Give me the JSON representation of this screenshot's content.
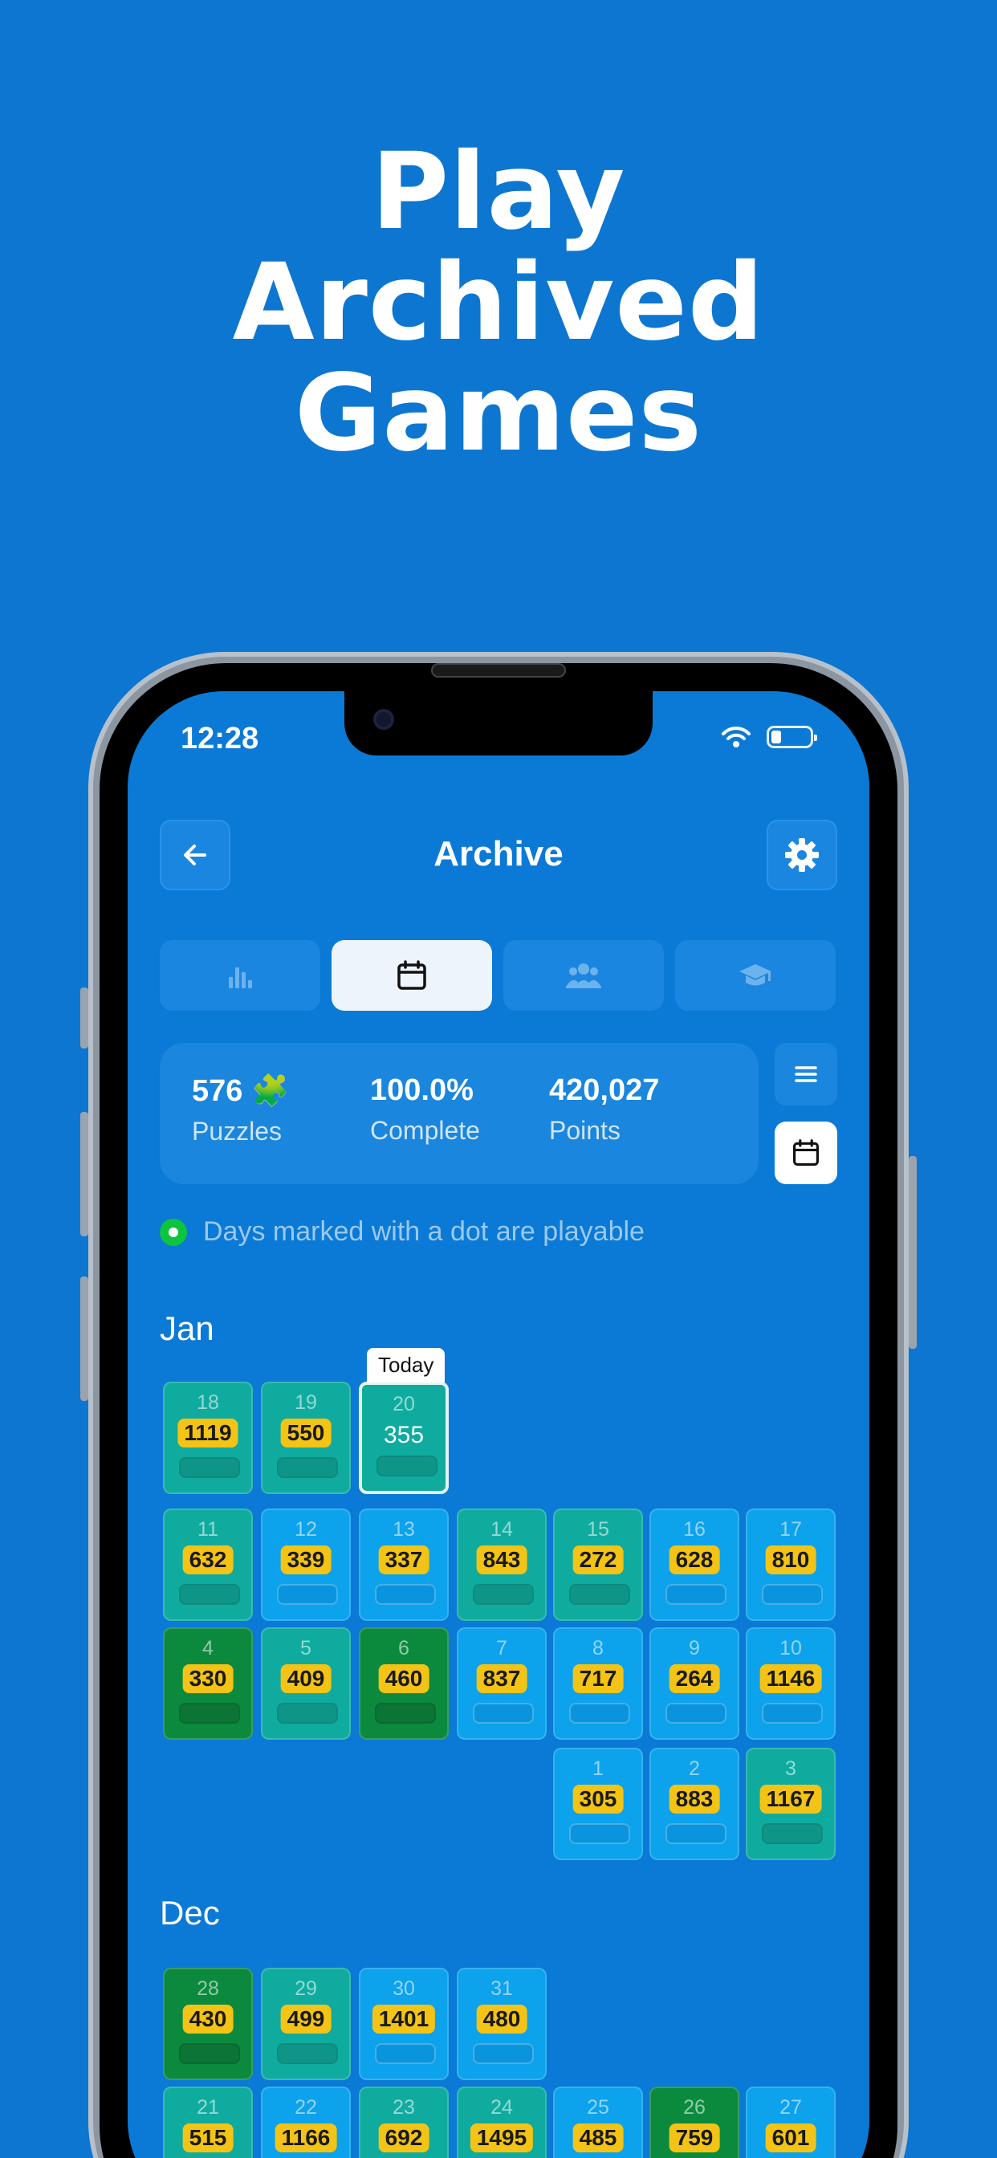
{
  "headline": [
    "Play",
    "Archived",
    "Games"
  ],
  "status_bar": {
    "time": "12:28"
  },
  "header": {
    "title": "Archive"
  },
  "tabs": [
    {
      "icon": "bar-chart-icon",
      "active": false
    },
    {
      "icon": "calendar-icon",
      "active": true
    },
    {
      "icon": "group-icon",
      "active": false
    },
    {
      "icon": "graduation-cap-icon",
      "active": false
    }
  ],
  "stats": {
    "puzzles": {
      "value": "576 🧩",
      "label": "Puzzles"
    },
    "complete": {
      "value": "100.0%",
      "label": "Complete"
    },
    "points": {
      "value": "420,027",
      "label": "Points"
    }
  },
  "hint": "Days marked with a dot are playable",
  "today_label": "Today",
  "months": [
    {
      "name": "Jan",
      "rows": [
        [
          {
            "day": "18",
            "score": "1119",
            "color": "teal"
          },
          {
            "day": "19",
            "score": "550",
            "color": "teal"
          },
          {
            "day": "20",
            "score": "355",
            "color": "teal",
            "today": true
          }
        ],
        [
          {
            "day": "11",
            "score": "632",
            "color": "teal"
          },
          {
            "day": "12",
            "score": "339",
            "color": "blue"
          },
          {
            "day": "13",
            "score": "337",
            "color": "blue"
          },
          {
            "day": "14",
            "score": "843",
            "color": "teal"
          },
          {
            "day": "15",
            "score": "272",
            "color": "teal"
          },
          {
            "day": "16",
            "score": "628",
            "color": "blue"
          },
          {
            "day": "17",
            "score": "810",
            "color": "blue"
          }
        ],
        [
          {
            "day": "4",
            "score": "330",
            "color": "green"
          },
          {
            "day": "5",
            "score": "409",
            "color": "teal"
          },
          {
            "day": "6",
            "score": "460",
            "color": "green"
          },
          {
            "day": "7",
            "score": "837",
            "color": "blue"
          },
          {
            "day": "8",
            "score": "717",
            "color": "blue"
          },
          {
            "day": "9",
            "score": "264",
            "color": "blue"
          },
          {
            "day": "10",
            "score": "1146",
            "color": "blue"
          }
        ],
        [
          {
            "day": "1",
            "score": "305",
            "color": "blue"
          },
          {
            "day": "2",
            "score": "883",
            "color": "blue"
          },
          {
            "day": "3",
            "score": "1167",
            "color": "teal"
          }
        ]
      ]
    },
    {
      "name": "Dec",
      "rows": [
        [
          {
            "day": "28",
            "score": "430",
            "color": "green"
          },
          {
            "day": "29",
            "score": "499",
            "color": "teal"
          },
          {
            "day": "30",
            "score": "1401",
            "color": "blue"
          },
          {
            "day": "31",
            "score": "480",
            "color": "blue"
          }
        ],
        [
          {
            "day": "21",
            "score": "515",
            "color": "teal"
          },
          {
            "day": "22",
            "score": "1166",
            "color": "blue"
          },
          {
            "day": "23",
            "score": "692",
            "color": "teal"
          },
          {
            "day": "24",
            "score": "1495",
            "color": "teal"
          },
          {
            "day": "25",
            "score": "485",
            "color": "blue"
          },
          {
            "day": "26",
            "score": "759",
            "color": "green"
          },
          {
            "day": "27",
            "score": "601",
            "color": "blue"
          }
        ]
      ]
    }
  ]
}
